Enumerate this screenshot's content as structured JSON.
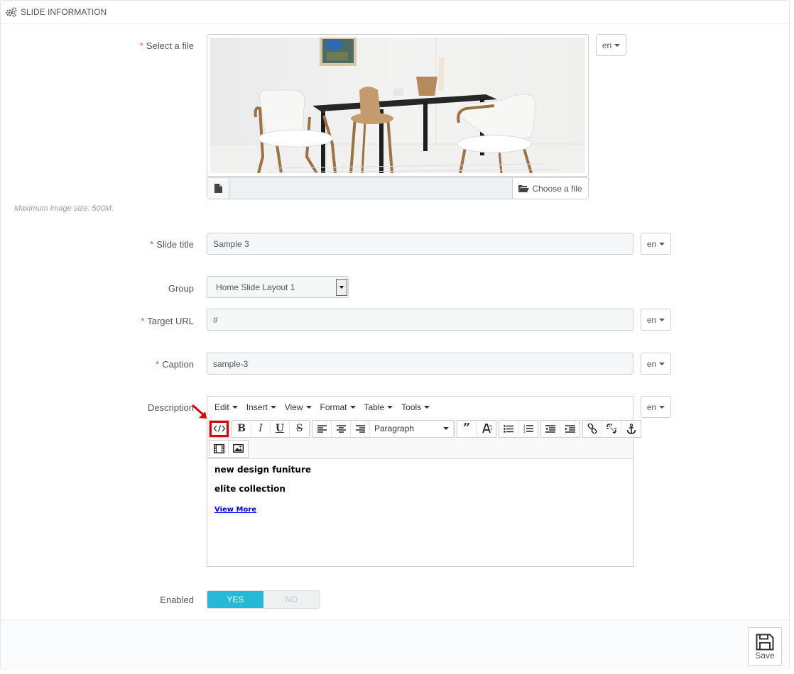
{
  "panel": {
    "title": "SLIDE INFORMATION",
    "icon": "gears-icon"
  },
  "fields": {
    "file": {
      "label": "Select a file",
      "lang": "en",
      "choose_label": "Choose a file",
      "hint": "Maximum image size: 500M."
    },
    "slide_title": {
      "label": "Slide title",
      "value": "Sample 3",
      "lang": "en"
    },
    "group": {
      "label": "Group",
      "value": "Home Slide Layout 1"
    },
    "target_url": {
      "label": "Target URL",
      "value": "#",
      "lang": "en"
    },
    "caption": {
      "label": "Caption",
      "value": "sample-3",
      "lang": "en"
    },
    "description": {
      "label": "Description",
      "lang": "en",
      "menu": [
        "Edit",
        "Insert",
        "View",
        "Format",
        "Table",
        "Tools"
      ],
      "block_format": "Paragraph",
      "content": {
        "line1": "new design funiture",
        "line2": "elite collection",
        "link": "View More"
      }
    },
    "enabled": {
      "label": "Enabled",
      "yes": "YES",
      "no": "NO",
      "value": "YES"
    }
  },
  "footer": {
    "save_label": "Save"
  },
  "colors": {
    "accent": "#25b9d7",
    "required": "#e3513a",
    "highlight": "#e00000"
  }
}
